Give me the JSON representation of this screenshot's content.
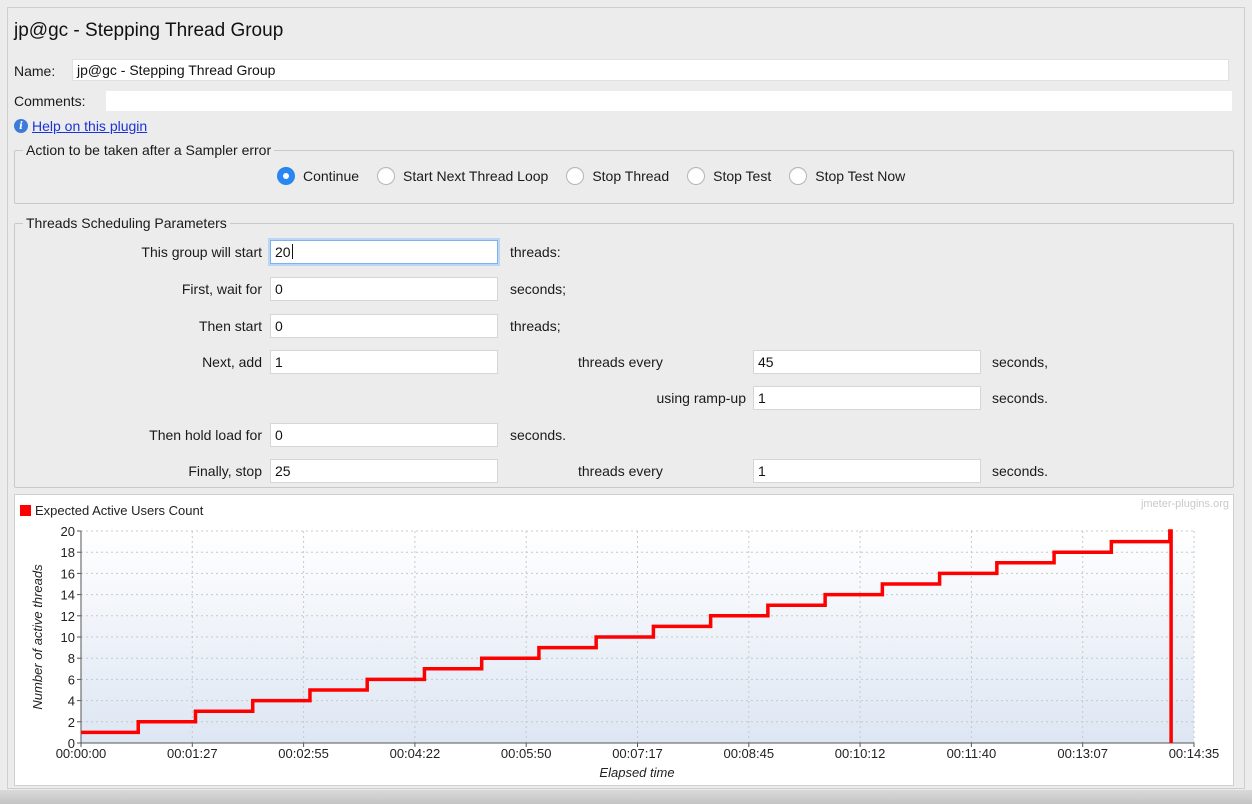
{
  "header": {
    "title": "jp@gc - Stepping Thread Group",
    "name_label": "Name:",
    "name_value": "jp@gc - Stepping Thread Group",
    "comments_label": "Comments:",
    "help_link": "Help on this plugin"
  },
  "sampler_error": {
    "title": "Action to be taken after a Sampler error",
    "options": [
      "Continue",
      "Start Next Thread Loop",
      "Stop Thread",
      "Stop Test",
      "Stop Test Now"
    ],
    "selected": "Continue"
  },
  "scheduling": {
    "title": "Threads Scheduling Parameters",
    "start_label": "This group will start",
    "start_value": "20",
    "start_unit": "threads:",
    "wait_label": "First, wait for",
    "wait_value": "0",
    "wait_unit": "seconds;",
    "then_start_label": "Then start",
    "then_start_value": "0",
    "then_start_unit": "threads;",
    "next_add_label": "Next, add",
    "next_add_value": "1",
    "next_add_every_label": "threads every",
    "next_add_every_value": "45",
    "next_add_every_unit": "seconds,",
    "rampup_label": "using ramp-up",
    "rampup_value": "1",
    "rampup_unit": "seconds.",
    "hold_label": "Then hold load for",
    "hold_value": "0",
    "hold_unit": "seconds.",
    "stop_label": "Finally, stop",
    "stop_value": "25",
    "stop_every_label": "threads every",
    "stop_every_value": "1",
    "stop_every_unit": "seconds."
  },
  "chart": {
    "watermark": "jmeter-plugins.org",
    "series_color": "#ff0000",
    "grid_color": "#c8c8c8"
  },
  "chart_data": {
    "type": "line",
    "xlabel": "Elapsed time",
    "ylabel": "Number of active threads",
    "ylim": [
      0,
      20
    ],
    "yticks": [
      0,
      2,
      4,
      6,
      8,
      10,
      12,
      14,
      16,
      18,
      20
    ],
    "xlim_seconds": [
      0,
      875
    ],
    "xticks": [
      "00:00:00",
      "00:01:27",
      "00:02:55",
      "00:04:22",
      "00:05:50",
      "00:07:17",
      "00:08:45",
      "00:10:12",
      "00:11:40",
      "00:13:07",
      "00:14:35"
    ],
    "grid": true,
    "legend": "top-left",
    "series": [
      {
        "name": "Expected Active Users Count",
        "x_seconds": [
          0,
          45,
          90,
          135,
          180,
          225,
          270,
          315,
          360,
          405,
          450,
          495,
          540,
          585,
          630,
          675,
          720,
          765,
          810,
          855,
          856,
          857
        ],
        "values": [
          1,
          2,
          3,
          4,
          5,
          6,
          7,
          8,
          9,
          10,
          11,
          12,
          13,
          14,
          15,
          16,
          17,
          18,
          19,
          19,
          20,
          0
        ]
      }
    ]
  },
  "footer": {}
}
